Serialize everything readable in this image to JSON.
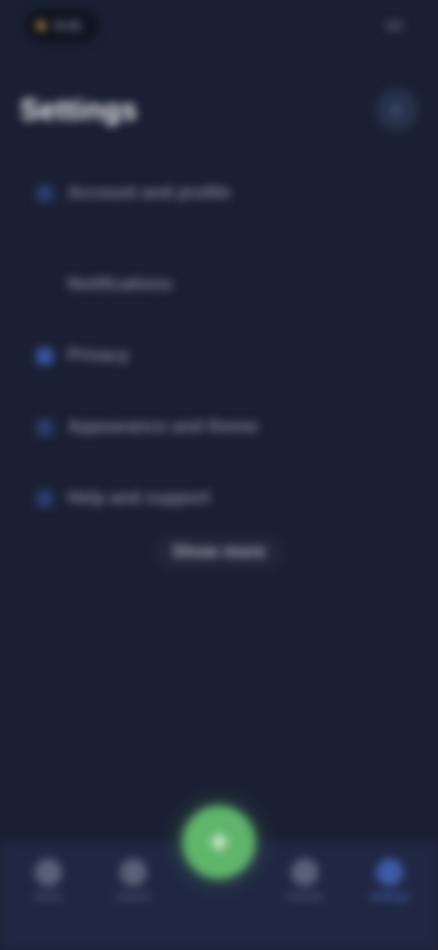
{
  "status_bar": {
    "time": "9:41",
    "right_text": "5G"
  },
  "header": {
    "title": "Settings",
    "action_icon": "search-icon",
    "action_glyph": "⌕"
  },
  "list": {
    "items": [
      {
        "label": "Account and profile",
        "icon": "user-icon",
        "meta": ""
      },
      {
        "label": "Notifications",
        "icon": "bell-icon",
        "meta": ""
      },
      {
        "label": "Privacy",
        "icon": "lock-icon",
        "meta": ""
      },
      {
        "label": "Appearance and theme",
        "icon": "palette-icon",
        "meta": ""
      },
      {
        "label": "Help and support",
        "icon": "help-icon",
        "meta": ""
      }
    ],
    "show_more_label": "Show more"
  },
  "bottom_nav": {
    "items": [
      {
        "label": "Home",
        "icon": "home-icon",
        "active": false
      },
      {
        "label": "Search",
        "icon": "search-icon",
        "active": false
      },
      {
        "label": "Activity",
        "icon": "activity-icon",
        "active": false
      },
      {
        "label": "Settings",
        "icon": "gear-icon",
        "active": true
      }
    ],
    "fab_icon": "plus-icon",
    "fab_glyph": "+"
  },
  "colors": {
    "background": "#1a2033",
    "accent": "#3e5ba8",
    "fab": "#5fb56a"
  }
}
